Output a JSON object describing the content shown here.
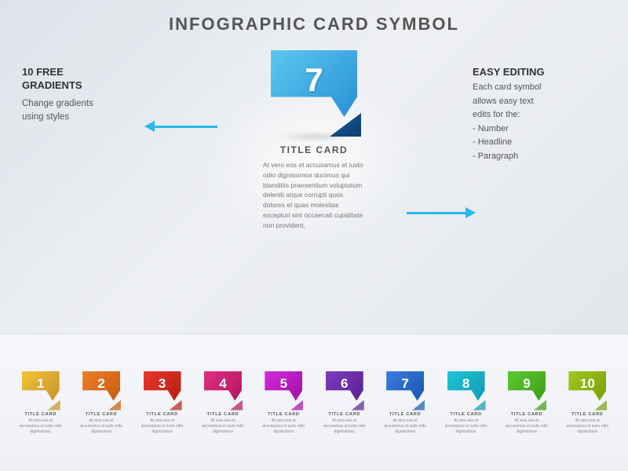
{
  "page": {
    "title": "INFOGRAPHIC CARD SYMBOL",
    "background_color": "#e2e7ed"
  },
  "left_annotation": {
    "heading": "10 FREE\nGRADIENTS",
    "body": "Change gradients\nusing styles"
  },
  "right_annotation": {
    "heading": "EASY EDITING",
    "body": "Each card symbol\nallows easy text\nedits for the:\n- Number\n- Headline\n- Paragraph"
  },
  "center_card": {
    "number": "7",
    "title": "TITLE CARD",
    "body": "At vero eos et accusamus et iusto odio dignissimos ducimus qui blanditiis praesentium voluptatum deleniti atque corrupti quos dolores et quas molestias excepturi sint occaecati cupiditate non provident,"
  },
  "cards": [
    {
      "number": "1",
      "color": "#f5c335",
      "fold_color": "#c4922a",
      "title": "TITLE CARD",
      "body": "At vero eos et accusamus et iusto odio dignissimos"
    },
    {
      "number": "2",
      "color": "#f07e2a",
      "fold_color": "#c45c10",
      "title": "TITLE CARD",
      "body": "At vero eos et accusamus et iusto odio dignissimos"
    },
    {
      "number": "3",
      "color": "#e8362a",
      "fold_color": "#b51f14",
      "title": "TITLE CARD",
      "body": "At vero eos et accusamus et iusto odio dignissimos"
    },
    {
      "number": "4",
      "color": "#e02f82",
      "fold_color": "#b01560",
      "title": "TITLE CARD",
      "body": "At vero eos et accusamus et iusto odio dignissimos"
    },
    {
      "number": "5",
      "color": "#d42adc",
      "fold_color": "#9e10a6",
      "title": "TITLE CARD",
      "body": "At vero eos et accusamus et iusto odio dignissimos"
    },
    {
      "number": "6",
      "color": "#7c3dc0",
      "fold_color": "#5a2090",
      "title": "TITLE CARD",
      "body": "At vero eos et accusamus et iusto odio dignissimos"
    },
    {
      "number": "7",
      "color": "#3a7de0",
      "fold_color": "#1a55b0",
      "title": "TITLE CARD",
      "body": "At vero eos et accusamus et iusto odio dignissimos"
    },
    {
      "number": "8",
      "color": "#22c4d8",
      "fold_color": "#109ab0",
      "title": "TITLE CARD",
      "body": "At vero eos et accusamus et iusto odio dignissimos"
    },
    {
      "number": "9",
      "color": "#5ec832",
      "fold_color": "#3a9e14",
      "title": "TITLE CARD",
      "body": "At vero eos et accusamus et iusto odio dignissimos"
    },
    {
      "number": "10",
      "color": "#a0c820",
      "fold_color": "#789e08",
      "title": "TITLE CARD",
      "body": "At vero eos et accusamus et iusto odio dignissimos"
    }
  ]
}
